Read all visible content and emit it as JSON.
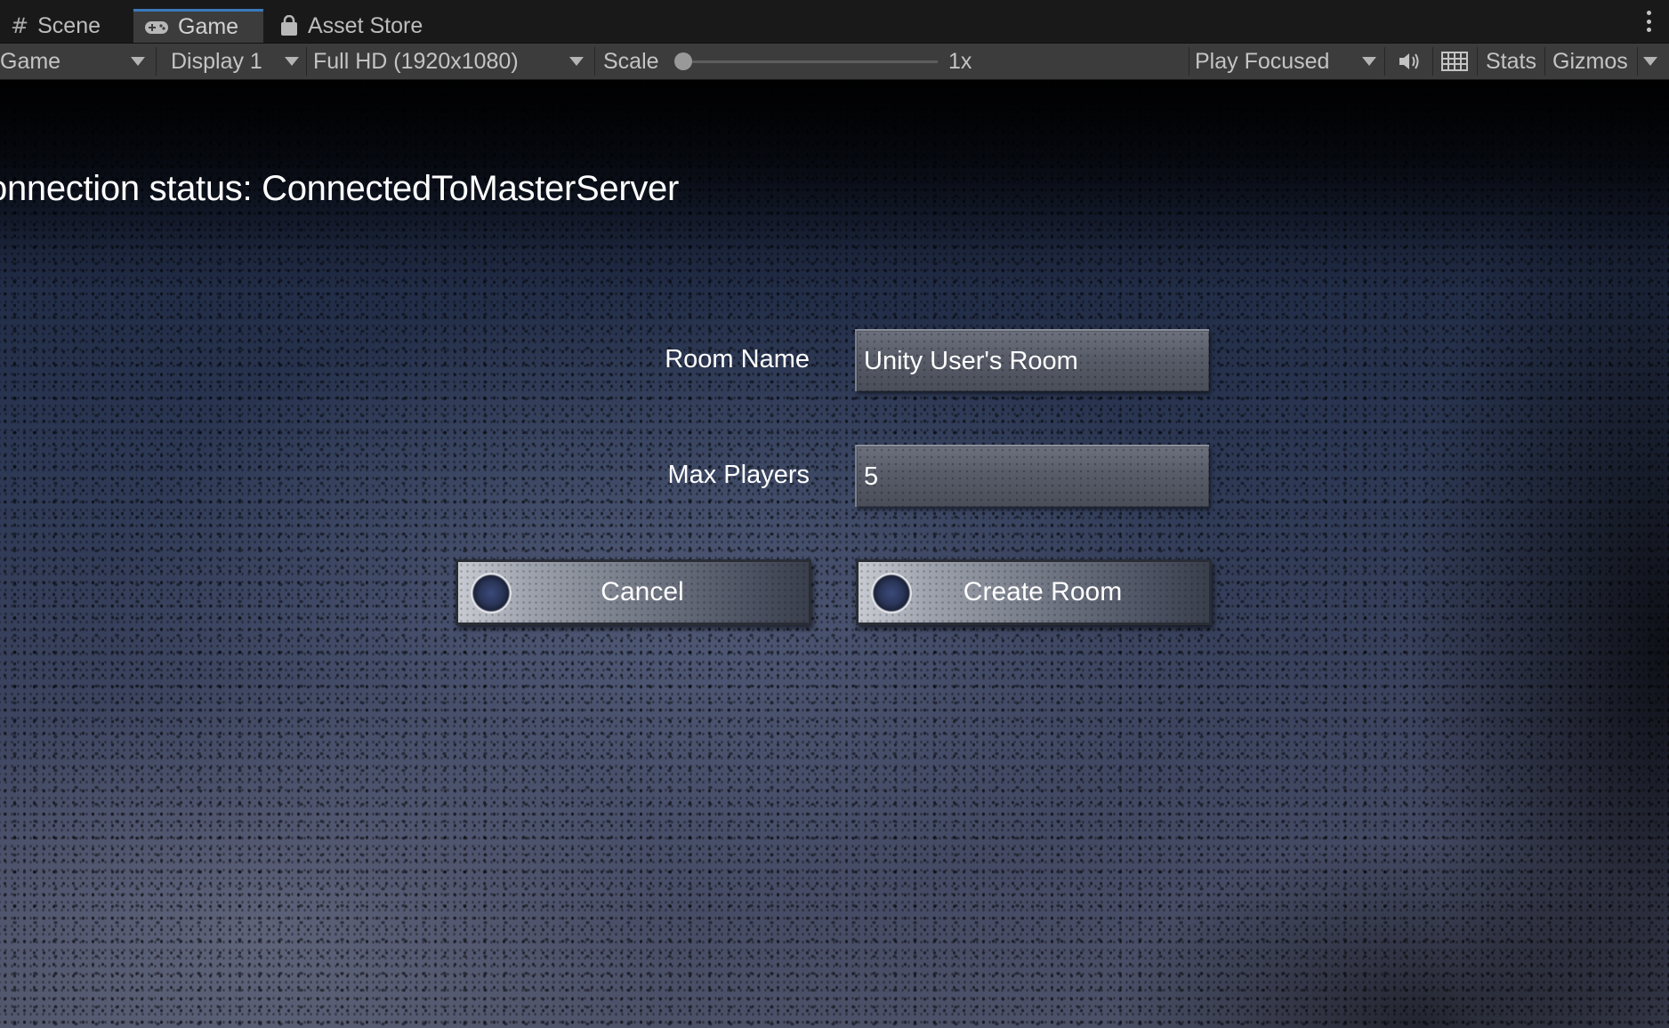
{
  "tabs": [
    {
      "label": "Scene",
      "icon": "hash-icon",
      "active": false
    },
    {
      "label": "Game",
      "icon": "gamepad-icon",
      "active": true
    },
    {
      "label": "Asset Store",
      "icon": "shopping-bag-icon",
      "active": false
    }
  ],
  "toolbar": {
    "view_mode": "Game",
    "display": "Display 1",
    "resolution": "Full HD (1920x1080)",
    "scale_label": "Scale",
    "scale_value": "1x",
    "scale_fraction": 0,
    "play_mode": "Play Focused",
    "stats_label": "Stats",
    "gizmos_label": "Gizmos"
  },
  "game": {
    "status_text": "onnection status: ConnectedToMasterServer",
    "room_name_label": "Room Name",
    "room_name_value": "Unity User's Room",
    "max_players_label": "Max Players",
    "max_players_value": "5",
    "cancel_label": "Cancel",
    "create_room_label": "Create Room"
  },
  "colors": {
    "tab_accent": "#3a79bb",
    "editor_bg": "#3c3c3c",
    "text_white": "#ffffff"
  }
}
